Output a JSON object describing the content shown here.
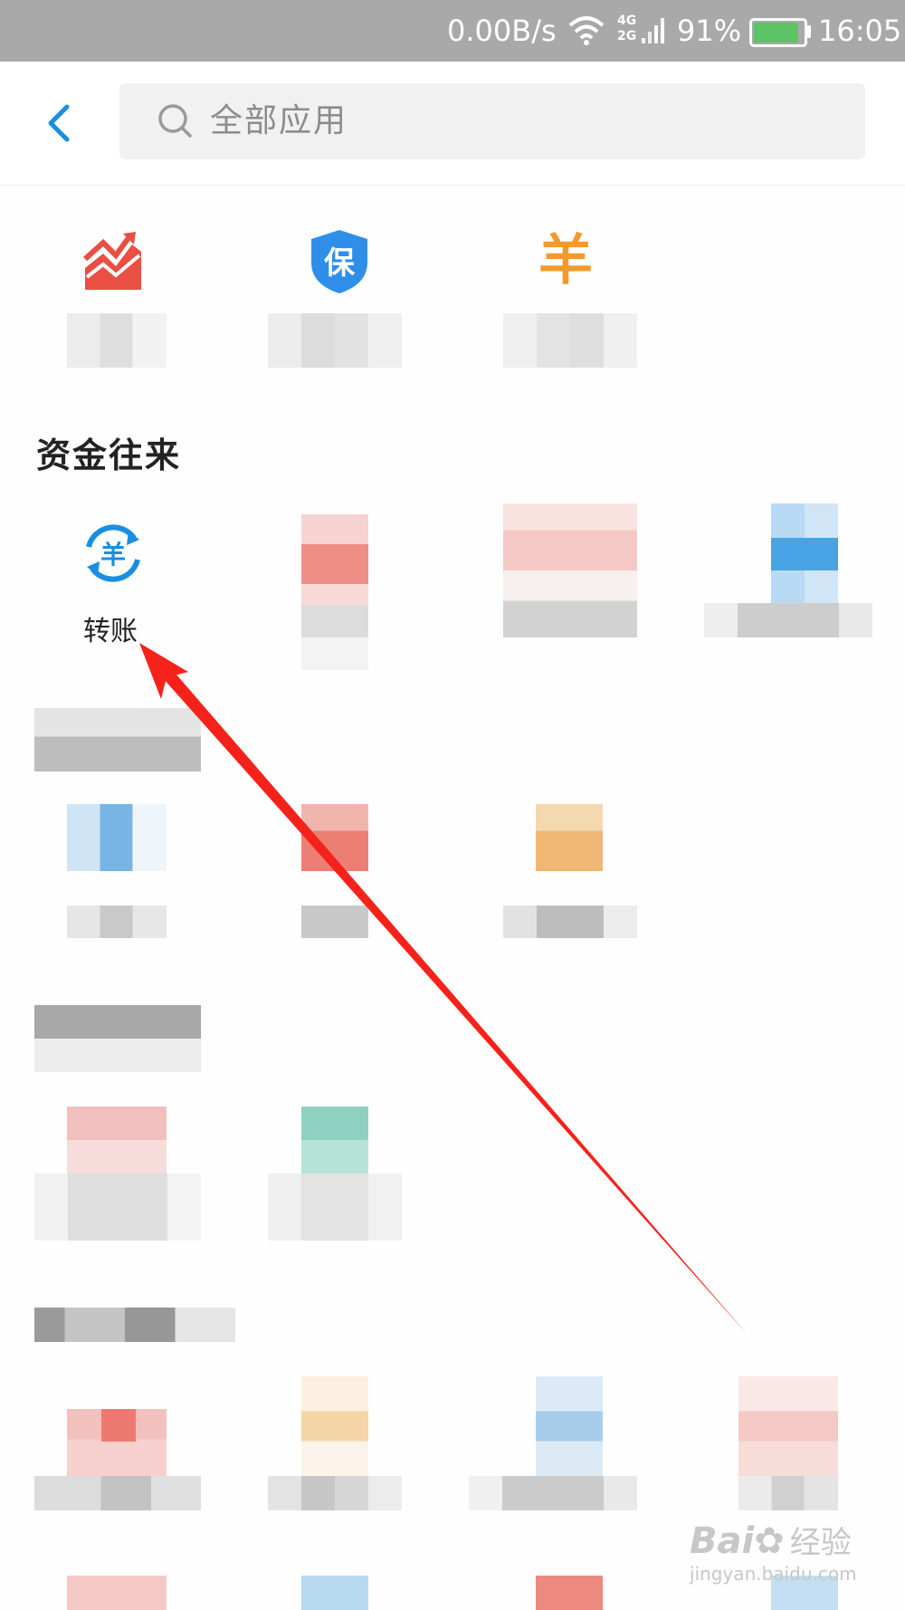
{
  "status_bar": {
    "network_speed": "0.00B/s",
    "signal_labels": [
      "4G",
      "2G"
    ],
    "battery_percent": "91%",
    "battery_level": 0.91,
    "time": "16:05"
  },
  "header": {
    "search_placeholder": "全部应用"
  },
  "top_apps": [
    {
      "icon": "stock-chart-icon",
      "color": "#e94f43"
    },
    {
      "icon": "insurance-shield-icon",
      "color": "#2f8fe8",
      "glyph": "保"
    },
    {
      "icon": "yuan-icon",
      "color": "#f29a2e",
      "glyph": "羊"
    }
  ],
  "section": {
    "title": "资金往来",
    "apps": [
      {
        "label": "转账",
        "icon": "transfer-icon",
        "glyph": "羊",
        "color": "#1a8ee0"
      }
    ]
  },
  "watermark": {
    "brand_left": "Bai",
    "brand_right": "经验",
    "url": "jingyan.baidu.com"
  },
  "colors": {
    "accent": "#1a8ee0",
    "arrow": "#f5221b",
    "status_bar_bg": "#a9a9a9"
  }
}
